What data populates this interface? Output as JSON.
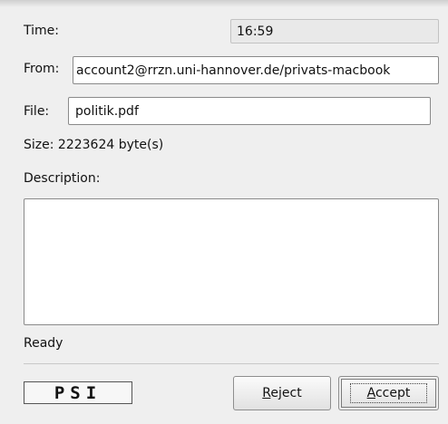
{
  "time": {
    "label": "Time:",
    "value": "16:59"
  },
  "from": {
    "label": "From:",
    "value": "account2@rrzn.uni-hannover.de/privats-macbook"
  },
  "file": {
    "label": "File:",
    "value": "politik.pdf"
  },
  "size": {
    "label": "Size:",
    "value": "2223624 byte(s)"
  },
  "description": {
    "label": "Description:",
    "value": ""
  },
  "status": "Ready",
  "logo": {
    "text": "PSI"
  },
  "buttons": {
    "reject": {
      "mnemonic": "R",
      "rest": "eject"
    },
    "accept": {
      "mnemonic": "A",
      "rest": "ccept"
    }
  }
}
